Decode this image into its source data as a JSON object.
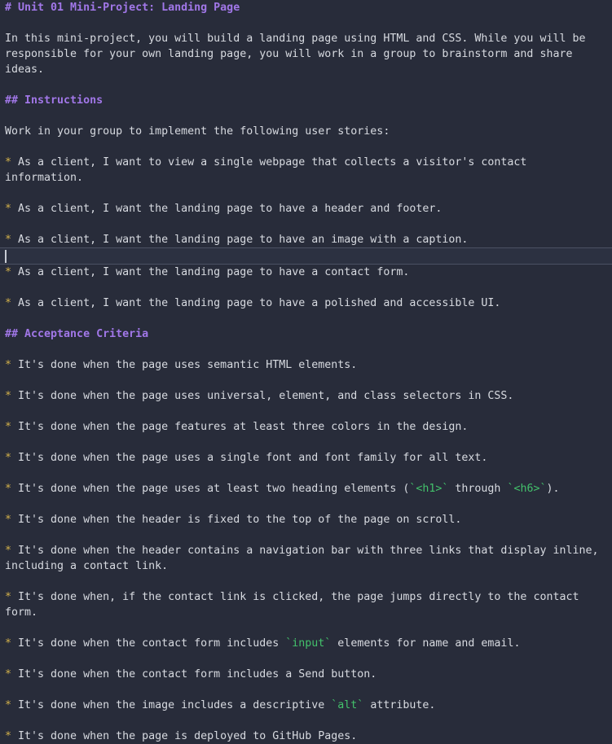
{
  "editor": {
    "theme_background": "#282c3a",
    "text_color": "#d7dae0",
    "heading_color": "#a177e8",
    "bullet_color": "#d3b14a",
    "code_color": "#43c16b",
    "active_line_background": "#2c3141",
    "active_line_border": "#4b5163",
    "caret_color": "#c8ccd4"
  },
  "document": {
    "title_line": "# Unit 01 Mini-Project: Landing Page",
    "intro_paragraph": "In this mini-project, you will build a landing page using HTML and CSS. While you will be responsible for your own landing page, you will work in a group to brainstorm and share ideas.",
    "instructions_heading": "## Instructions",
    "instructions_intro": "Work in your group to implement the following user stories:",
    "user_stories": [
      {
        "bullet": "*",
        "text": "As a client, I want to view a single webpage that collects a visitor's contact information."
      },
      {
        "bullet": "*",
        "text": "As a client, I want the landing page to have a header and footer."
      },
      {
        "bullet": "*",
        "text": "As a client, I want the landing page to have an image with a caption."
      },
      {
        "bullet": "*",
        "text": "As a client, I want the landing page to have a contact form."
      },
      {
        "bullet": "*",
        "text": "As a client, I want the landing page to have a polished and accessible UI."
      }
    ],
    "acceptance_heading": "## Acceptance Criteria",
    "acceptance_criteria": [
      {
        "bullet": "*",
        "parts": [
          {
            "type": "text",
            "value": "It's done when the page uses semantic HTML elements."
          }
        ]
      },
      {
        "bullet": "*",
        "parts": [
          {
            "type": "text",
            "value": "It's done when the page uses universal, element, and class selectors in CSS."
          }
        ]
      },
      {
        "bullet": "*",
        "parts": [
          {
            "type": "text",
            "value": "It's done when the page features at least three colors in the design."
          }
        ]
      },
      {
        "bullet": "*",
        "parts": [
          {
            "type": "text",
            "value": "It's done when the page uses a single font and font family for all text."
          }
        ]
      },
      {
        "bullet": "*",
        "parts": [
          {
            "type": "text",
            "value": "It's done when the page uses at least two heading elements ("
          },
          {
            "type": "code",
            "value": "`<h1>`"
          },
          {
            "type": "text",
            "value": " through "
          },
          {
            "type": "code",
            "value": "`<h6>`"
          },
          {
            "type": "text",
            "value": ")."
          }
        ]
      },
      {
        "bullet": "*",
        "parts": [
          {
            "type": "text",
            "value": "It's done when the header is fixed to the top of the page on scroll."
          }
        ]
      },
      {
        "bullet": "*",
        "parts": [
          {
            "type": "text",
            "value": "It's done when the header contains a navigation bar with three links that display inline, including a contact link."
          }
        ]
      },
      {
        "bullet": "*",
        "parts": [
          {
            "type": "text",
            "value": "It's done when, if the contact link is clicked, the page jumps directly to the contact form."
          }
        ]
      },
      {
        "bullet": "*",
        "parts": [
          {
            "type": "text",
            "value": "It's done when the contact form includes "
          },
          {
            "type": "code",
            "value": "`input`"
          },
          {
            "type": "text",
            "value": " elements for name and email."
          }
        ]
      },
      {
        "bullet": "*",
        "parts": [
          {
            "type": "text",
            "value": "It's done when the contact form includes a Send button."
          }
        ]
      },
      {
        "bullet": "*",
        "parts": [
          {
            "type": "text",
            "value": "It's done when the image includes a descriptive "
          },
          {
            "type": "code",
            "value": "`alt`"
          },
          {
            "type": "text",
            "value": " attribute."
          }
        ]
      },
      {
        "bullet": "*",
        "parts": [
          {
            "type": "text",
            "value": "It's done when the page is deployed to GitHub Pages."
          }
        ]
      }
    ],
    "active_line": {
      "index_after_story": 3,
      "content": ""
    }
  }
}
